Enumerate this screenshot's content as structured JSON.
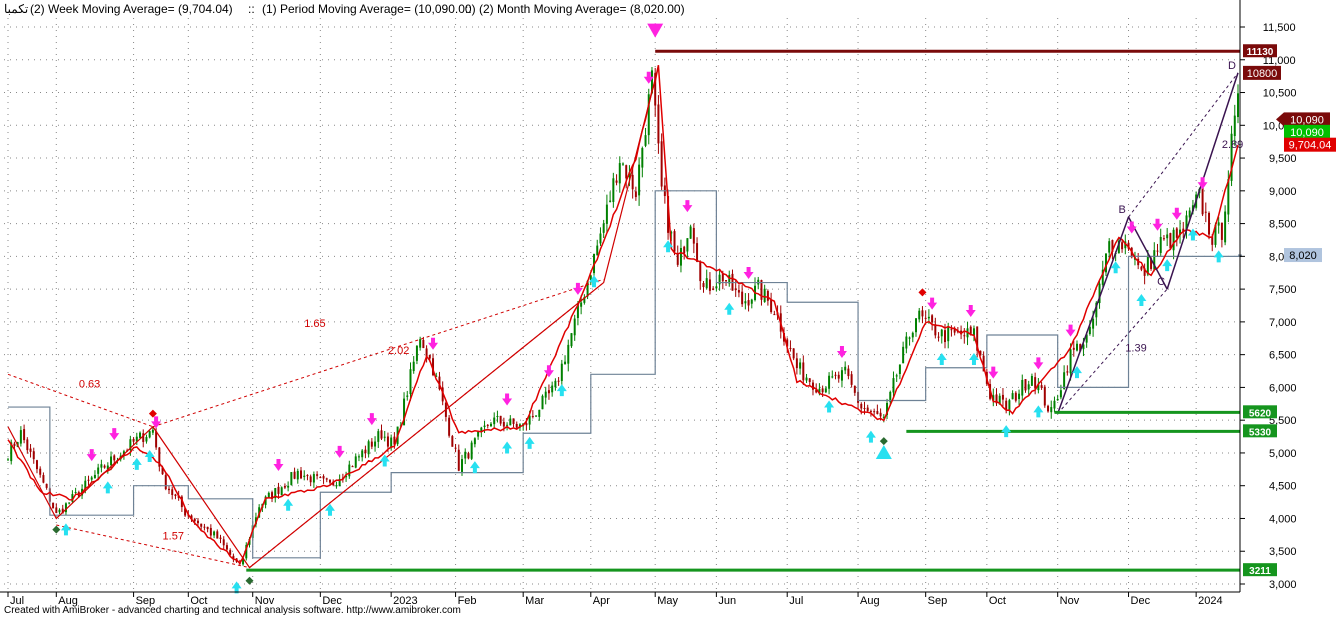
{
  "header": {
    "symbol": "تکمبا",
    "week_ma": "(2) Week Moving Average= (9,704.04)",
    "period_ma": "(1) Period Moving Average= (10,090.00)",
    "month_ma": "(2) Month Moving Average= (8,020.00)",
    "sep": "::"
  },
  "footer": {
    "text": "Created with AmiBroker - advanced charting and technical analysis software. http://www.amibroker.com"
  },
  "colors": {
    "up_candle": "#008000",
    "down_candle": "#a00000",
    "week_ma": "#e00000",
    "month_ma": "#6e8296",
    "support": "#15951e",
    "resistance": "#7a0a0a",
    "buy_arrow": "#27e0f0",
    "sell_arrow": "#ff22e0",
    "price_tag": "#7a0a0a"
  },
  "chart_data": {
    "type": "candlestick",
    "ylim": [
      2900,
      11700
    ],
    "y_ticks": [
      3000,
      3500,
      4000,
      4500,
      5000,
      5500,
      6000,
      6500,
      7000,
      7500,
      8000,
      8500,
      9000,
      9500,
      10000,
      10500,
      11000,
      11500
    ],
    "y_tick_labels": [
      "3,000",
      "3,500",
      "4,000",
      "4,500",
      "5,000",
      "5,500",
      "6,000",
      "6,500",
      "7,000",
      "7,500",
      "8,000",
      "8,500",
      "9,000",
      "9,500",
      "10,000",
      "10,500",
      "11,000",
      "11,500"
    ],
    "x_labels": [
      "Jul",
      "Aug",
      "Sep",
      "Oct",
      "Nov",
      "Dec",
      "2023",
      "Feb",
      "Mar",
      "Apr",
      "May",
      "Jun",
      "Jul",
      "Aug",
      "Sep",
      "Oct",
      "Nov",
      "Dec",
      "2024"
    ],
    "n_bars": 383,
    "month_starts": [
      0,
      15,
      39,
      56,
      76,
      97,
      119,
      139,
      160,
      181,
      201,
      220,
      242,
      264,
      285,
      304,
      326,
      348,
      369
    ],
    "price_anchors": [
      [
        0,
        5000
      ],
      [
        4,
        5300
      ],
      [
        13,
        4300
      ],
      [
        15,
        4050
      ],
      [
        20,
        4300
      ],
      [
        30,
        4800
      ],
      [
        40,
        5200
      ],
      [
        45,
        5350
      ],
      [
        48,
        4600
      ],
      [
        55,
        4100
      ],
      [
        65,
        3700
      ],
      [
        72,
        3250
      ],
      [
        78,
        4200
      ],
      [
        90,
        4700
      ],
      [
        100,
        4500
      ],
      [
        110,
        5000
      ],
      [
        116,
        5300
      ],
      [
        120,
        5100
      ],
      [
        128,
        6800
      ],
      [
        132,
        6300
      ],
      [
        140,
        4800
      ],
      [
        150,
        5500
      ],
      [
        160,
        5400
      ],
      [
        170,
        6000
      ],
      [
        178,
        7300
      ],
      [
        185,
        8500
      ],
      [
        190,
        9500
      ],
      [
        195,
        9000
      ],
      [
        200,
        10700
      ],
      [
        203,
        9000
      ],
      [
        208,
        7800
      ],
      [
        212,
        8600
      ],
      [
        216,
        7500
      ],
      [
        222,
        7700
      ],
      [
        228,
        7300
      ],
      [
        233,
        7500
      ],
      [
        238,
        7200
      ],
      [
        245,
        6300
      ],
      [
        252,
        6000
      ],
      [
        260,
        6200
      ],
      [
        265,
        5700
      ],
      [
        272,
        5500
      ],
      [
        276,
        6200
      ],
      [
        282,
        7100
      ],
      [
        290,
        6800
      ],
      [
        300,
        6800
      ],
      [
        305,
        5900
      ],
      [
        310,
        5700
      ],
      [
        318,
        6200
      ],
      [
        324,
        5600
      ],
      [
        330,
        6500
      ],
      [
        336,
        6800
      ],
      [
        342,
        8200
      ],
      [
        348,
        8200
      ],
      [
        352,
        7700
      ],
      [
        358,
        8200
      ],
      [
        364,
        8300
      ],
      [
        370,
        8900
      ],
      [
        374,
        8300
      ],
      [
        377,
        8400
      ],
      [
        380,
        9700
      ],
      [
        383,
        10600
      ]
    ],
    "week_ma_anchors": [
      [
        0,
        5200
      ],
      [
        10,
        4400
      ],
      [
        20,
        4300
      ],
      [
        40,
        5100
      ],
      [
        48,
        4800
      ],
      [
        58,
        3900
      ],
      [
        72,
        3300
      ],
      [
        80,
        4300
      ],
      [
        100,
        4500
      ],
      [
        120,
        5100
      ],
      [
        130,
        6500
      ],
      [
        140,
        5300
      ],
      [
        160,
        5400
      ],
      [
        180,
        7600
      ],
      [
        195,
        9500
      ],
      [
        202,
        10900
      ],
      [
        206,
        8100
      ],
      [
        220,
        7800
      ],
      [
        238,
        7300
      ],
      [
        245,
        6100
      ],
      [
        262,
        5700
      ],
      [
        272,
        5500
      ],
      [
        285,
        7000
      ],
      [
        300,
        6800
      ],
      [
        306,
        5800
      ],
      [
        312,
        5600
      ],
      [
        330,
        6600
      ],
      [
        345,
        8300
      ],
      [
        355,
        7700
      ],
      [
        365,
        8400
      ],
      [
        374,
        8300
      ],
      [
        382,
        9700
      ]
    ],
    "month_ma_steps": [
      [
        0,
        5700
      ],
      [
        13,
        4050
      ],
      [
        39,
        4500
      ],
      [
        56,
        4300
      ],
      [
        76,
        3400
      ],
      [
        97,
        4400
      ],
      [
        119,
        4700
      ],
      [
        160,
        5300
      ],
      [
        181,
        6200
      ],
      [
        201,
        9000
      ],
      [
        220,
        7600
      ],
      [
        242,
        7300
      ],
      [
        264,
        5800
      ],
      [
        285,
        6300
      ],
      [
        304,
        6800
      ],
      [
        326,
        6000
      ],
      [
        348,
        8000
      ],
      [
        383,
        8020
      ]
    ],
    "levels": [
      {
        "label": "11130",
        "value": 11130,
        "start": 201,
        "kind": "resistance"
      },
      {
        "label": "5620",
        "value": 5620,
        "start": 325,
        "kind": "support"
      },
      {
        "label": "5330",
        "value": 5330,
        "start": 279,
        "kind": "support"
      },
      {
        "label": "3211",
        "value": 3211,
        "start": 74,
        "kind": "support"
      }
    ],
    "price_tags": [
      {
        "label": "10800",
        "value": 10800,
        "style": "resistance"
      },
      {
        "label": "10,090",
        "value": 10090,
        "style": "dark-arrow"
      },
      {
        "label": "10,090",
        "value": 9900,
        "style": "green"
      },
      {
        "label": "9,704.04",
        "value": 9704,
        "style": "red"
      },
      {
        "label": "8,020",
        "value": 8020,
        "style": "blue"
      }
    ],
    "zigzag_red": [
      [
        0,
        5400
      ],
      [
        15,
        4000
      ],
      [
        45,
        5400
      ],
      [
        75,
        3250
      ],
      [
        185,
        7600
      ],
      [
        202,
        10900
      ]
    ],
    "fib_lines": [
      {
        "from": [
          0,
          6200
        ],
        "to": [
          45,
          5400
        ],
        "label": "0.63",
        "at": [
          22,
          6000
        ]
      },
      {
        "from": [
          15,
          3900
        ],
        "to": [
          75,
          3250
        ],
        "label": "1.57",
        "at": [
          48,
          3680
        ]
      },
      {
        "from": [
          45,
          5400
        ],
        "to": [
          185,
          7650
        ],
        "label": "1.65",
        "at": [
          92,
          6920
        ]
      },
      {
        "from": [
          75,
          3250
        ],
        "to": [
          185,
          7600
        ],
        "label": "2.02",
        "at": [
          118,
          6510
        ]
      }
    ],
    "abcd": {
      "points": [
        [
          326,
          5600
        ],
        [
          348,
          8600
        ],
        [
          360,
          7500
        ],
        [
          382,
          10800
        ]
      ],
      "labels": [
        "",
        "B",
        "C",
        "D"
      ],
      "ratios": [
        {
          "text": "1.39",
          "at": [
            347,
            6550
          ]
        },
        {
          "text": "2.89",
          "at": [
            377,
            9650
          ]
        }
      ]
    },
    "pivot_marks": [
      {
        "bar": 15,
        "value": 3830,
        "color": "#2a6a30"
      },
      {
        "bar": 45,
        "value": 5600,
        "color": "#e00000"
      },
      {
        "bar": 75,
        "value": 3050,
        "color": "#2a6a30"
      },
      {
        "bar": 201,
        "value": 11500,
        "color": "#ff22e0"
      },
      {
        "bar": 284,
        "value": 7450,
        "color": "#e00000"
      },
      {
        "bar": 272,
        "value": 5180,
        "color": "#2a6a30"
      }
    ],
    "big_markers": [
      {
        "bar": 201,
        "value": 11430,
        "dir": "down",
        "color": "#ff22e0"
      },
      {
        "bar": 272,
        "value": 5030,
        "dir": "up",
        "color": "#27e0f0"
      }
    ],
    "buy_bars": [
      18,
      31,
      40,
      44,
      71,
      87,
      100,
      117,
      145,
      155,
      162,
      172,
      182,
      205,
      224,
      255,
      268,
      290,
      300,
      310,
      320,
      332,
      344,
      352,
      360,
      368,
      376
    ],
    "sell_bars": [
      26,
      33,
      46,
      84,
      103,
      113,
      132,
      155,
      168,
      177,
      199,
      211,
      230,
      259,
      287,
      299,
      306,
      320,
      330,
      349,
      357,
      363,
      371
    ],
    "month_labels_note": ""
  }
}
